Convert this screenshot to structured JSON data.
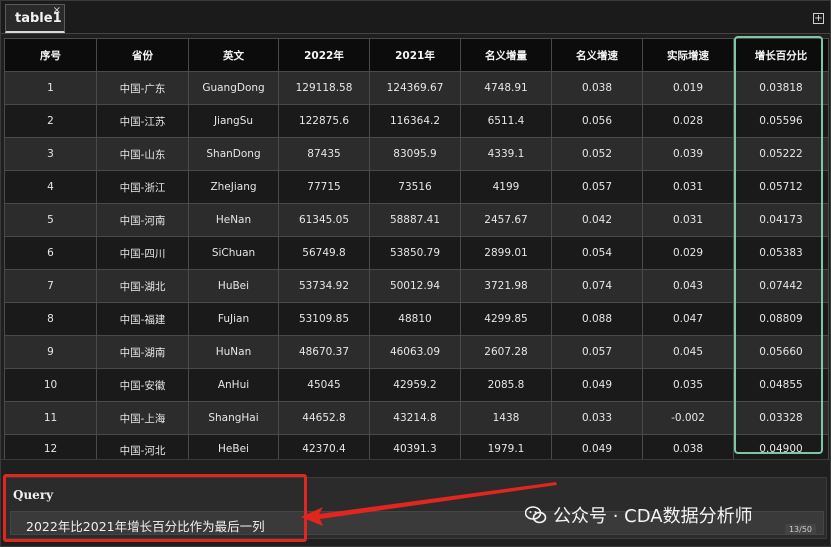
{
  "tab": {
    "label": "table1",
    "close": "×",
    "add": "+"
  },
  "table": {
    "headers": [
      "序号",
      "省份",
      "英文",
      "2022年",
      "2021年",
      "名义增量",
      "名义增速",
      "实际增速",
      "增长百分比"
    ],
    "rows": [
      [
        "1",
        "中国-广东",
        "GuangDong",
        "129118.58",
        "124369.67",
        "4748.91",
        "0.038",
        "0.019",
        "0.03818"
      ],
      [
        "2",
        "中国-江苏",
        "JiangSu",
        "122875.6",
        "116364.2",
        "6511.4",
        "0.056",
        "0.028",
        "0.05596"
      ],
      [
        "3",
        "中国-山东",
        "ShanDong",
        "87435",
        "83095.9",
        "4339.1",
        "0.052",
        "0.039",
        "0.05222"
      ],
      [
        "4",
        "中国-浙江",
        "ZheJiang",
        "77715",
        "73516",
        "4199",
        "0.057",
        "0.031",
        "0.05712"
      ],
      [
        "5",
        "中国-河南",
        "HeNan",
        "61345.05",
        "58887.41",
        "2457.67",
        "0.042",
        "0.031",
        "0.04173"
      ],
      [
        "6",
        "中国-四川",
        "SiChuan",
        "56749.8",
        "53850.79",
        "2899.01",
        "0.054",
        "0.029",
        "0.05383"
      ],
      [
        "7",
        "中国-湖北",
        "HuBei",
        "53734.92",
        "50012.94",
        "3721.98",
        "0.074",
        "0.043",
        "0.07442"
      ],
      [
        "8",
        "中国-福建",
        "FuJian",
        "53109.85",
        "48810",
        "4299.85",
        "0.088",
        "0.047",
        "0.08809"
      ],
      [
        "9",
        "中国-湖南",
        "HuNan",
        "48670.37",
        "46063.09",
        "2607.28",
        "0.057",
        "0.045",
        "0.05660"
      ],
      [
        "10",
        "中国-安徽",
        "AnHui",
        "45045",
        "42959.2",
        "2085.8",
        "0.049",
        "0.035",
        "0.04855"
      ],
      [
        "11",
        "中国-上海",
        "ShangHai",
        "44652.8",
        "43214.8",
        "1438",
        "0.033",
        "-0.002",
        "0.03328"
      ],
      [
        "12",
        "中国-河北",
        "HeBei",
        "42370.4",
        "40391.3",
        "1979.1",
        "0.049",
        "0.038",
        "0.04900"
      ]
    ]
  },
  "query": {
    "title": "Query",
    "text": "2022年比2021年增长百分比作为最后一列"
  },
  "watermark": {
    "text": "公众号 · CDA数据分析师"
  },
  "page_counter": "13/50",
  "colors": {
    "highlight_column": "#7fc6a4",
    "annotation_red": "#e0261e",
    "header_bg": "#0c0c0c",
    "row_odd": "#2c2c2c",
    "row_even": "#1a1a1a"
  }
}
